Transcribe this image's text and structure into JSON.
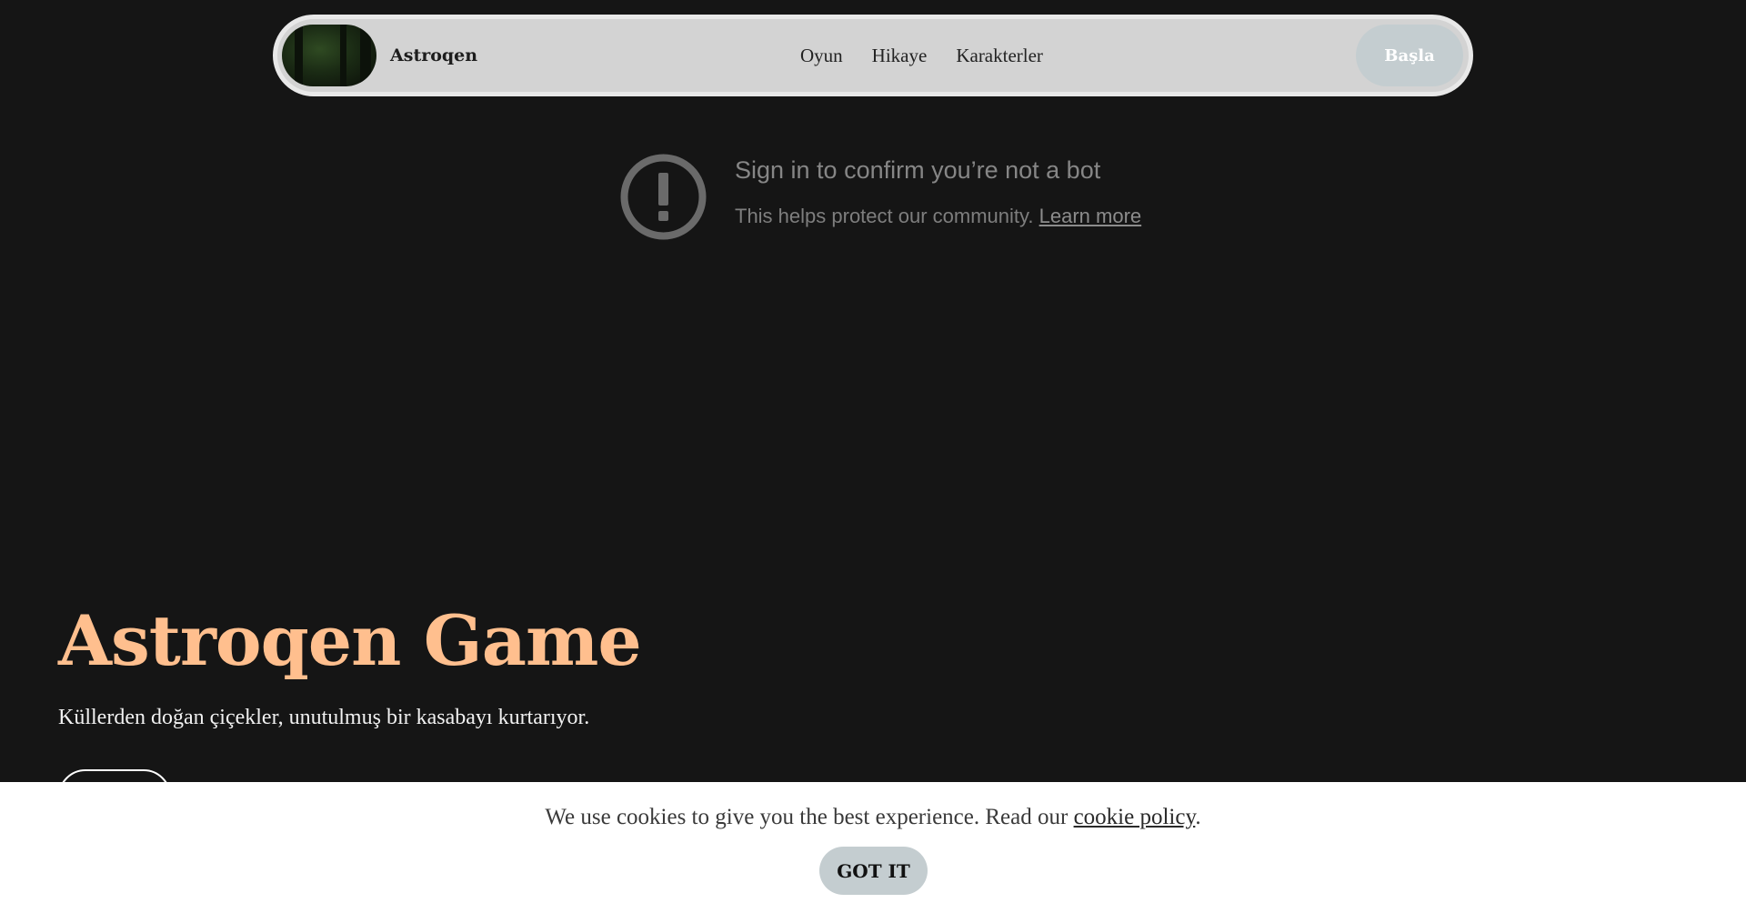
{
  "navbar": {
    "brand": "Astroqen",
    "links": [
      "Oyun",
      "Hikaye",
      "Karakterler"
    ],
    "start_label": "Başla"
  },
  "bot_notice": {
    "title": "Sign in to confirm you’re not a bot",
    "text": "This helps protect our community.",
    "link": "Learn more"
  },
  "hero": {
    "title": "Astroqen Game",
    "subtitle": "Küllerden doğan çiçekler, unutulmuş bir kasabayı kurtarıyor."
  },
  "cookie": {
    "text_before": "We use cookies to give you the best experience. Read our",
    "link": "cookie policy",
    "text_after": ".",
    "button": "GOT IT"
  },
  "colors": {
    "background": "#151515",
    "hero_title": "#ffbf8e",
    "button": "#c4cdd0"
  }
}
